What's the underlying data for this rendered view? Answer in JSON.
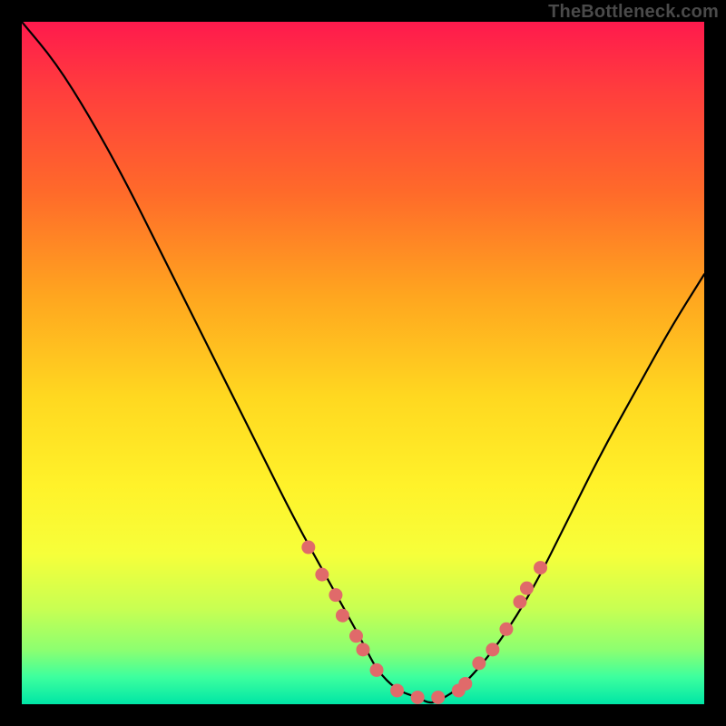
{
  "watermark": "TheBottleneck.com",
  "chart_data": {
    "type": "line",
    "title": "",
    "xlabel": "",
    "ylabel": "",
    "xlim": [
      0,
      100
    ],
    "ylim": [
      0,
      100
    ],
    "series": [
      {
        "name": "bottleneck-curve",
        "x": [
          0,
          5,
          10,
          15,
          20,
          25,
          30,
          35,
          40,
          45,
          50,
          52,
          55,
          58,
          60,
          62,
          65,
          70,
          75,
          80,
          85,
          90,
          95,
          100
        ],
        "y": [
          100,
          94,
          86,
          77,
          67,
          57,
          47,
          37,
          27,
          18,
          9,
          5,
          2,
          1,
          0,
          1,
          3,
          9,
          17,
          27,
          37,
          46,
          55,
          63
        ]
      }
    ],
    "markers": {
      "name": "highlight-dots",
      "color": "#e06a6a",
      "points": [
        {
          "x": 42,
          "y": 23
        },
        {
          "x": 44,
          "y": 19
        },
        {
          "x": 46,
          "y": 16
        },
        {
          "x": 47,
          "y": 13
        },
        {
          "x": 49,
          "y": 10
        },
        {
          "x": 50,
          "y": 8
        },
        {
          "x": 52,
          "y": 5
        },
        {
          "x": 55,
          "y": 2
        },
        {
          "x": 58,
          "y": 1
        },
        {
          "x": 61,
          "y": 1
        },
        {
          "x": 64,
          "y": 2
        },
        {
          "x": 65,
          "y": 3
        },
        {
          "x": 67,
          "y": 6
        },
        {
          "x": 69,
          "y": 8
        },
        {
          "x": 71,
          "y": 11
        },
        {
          "x": 73,
          "y": 15
        },
        {
          "x": 74,
          "y": 17
        },
        {
          "x": 76,
          "y": 20
        }
      ]
    }
  }
}
